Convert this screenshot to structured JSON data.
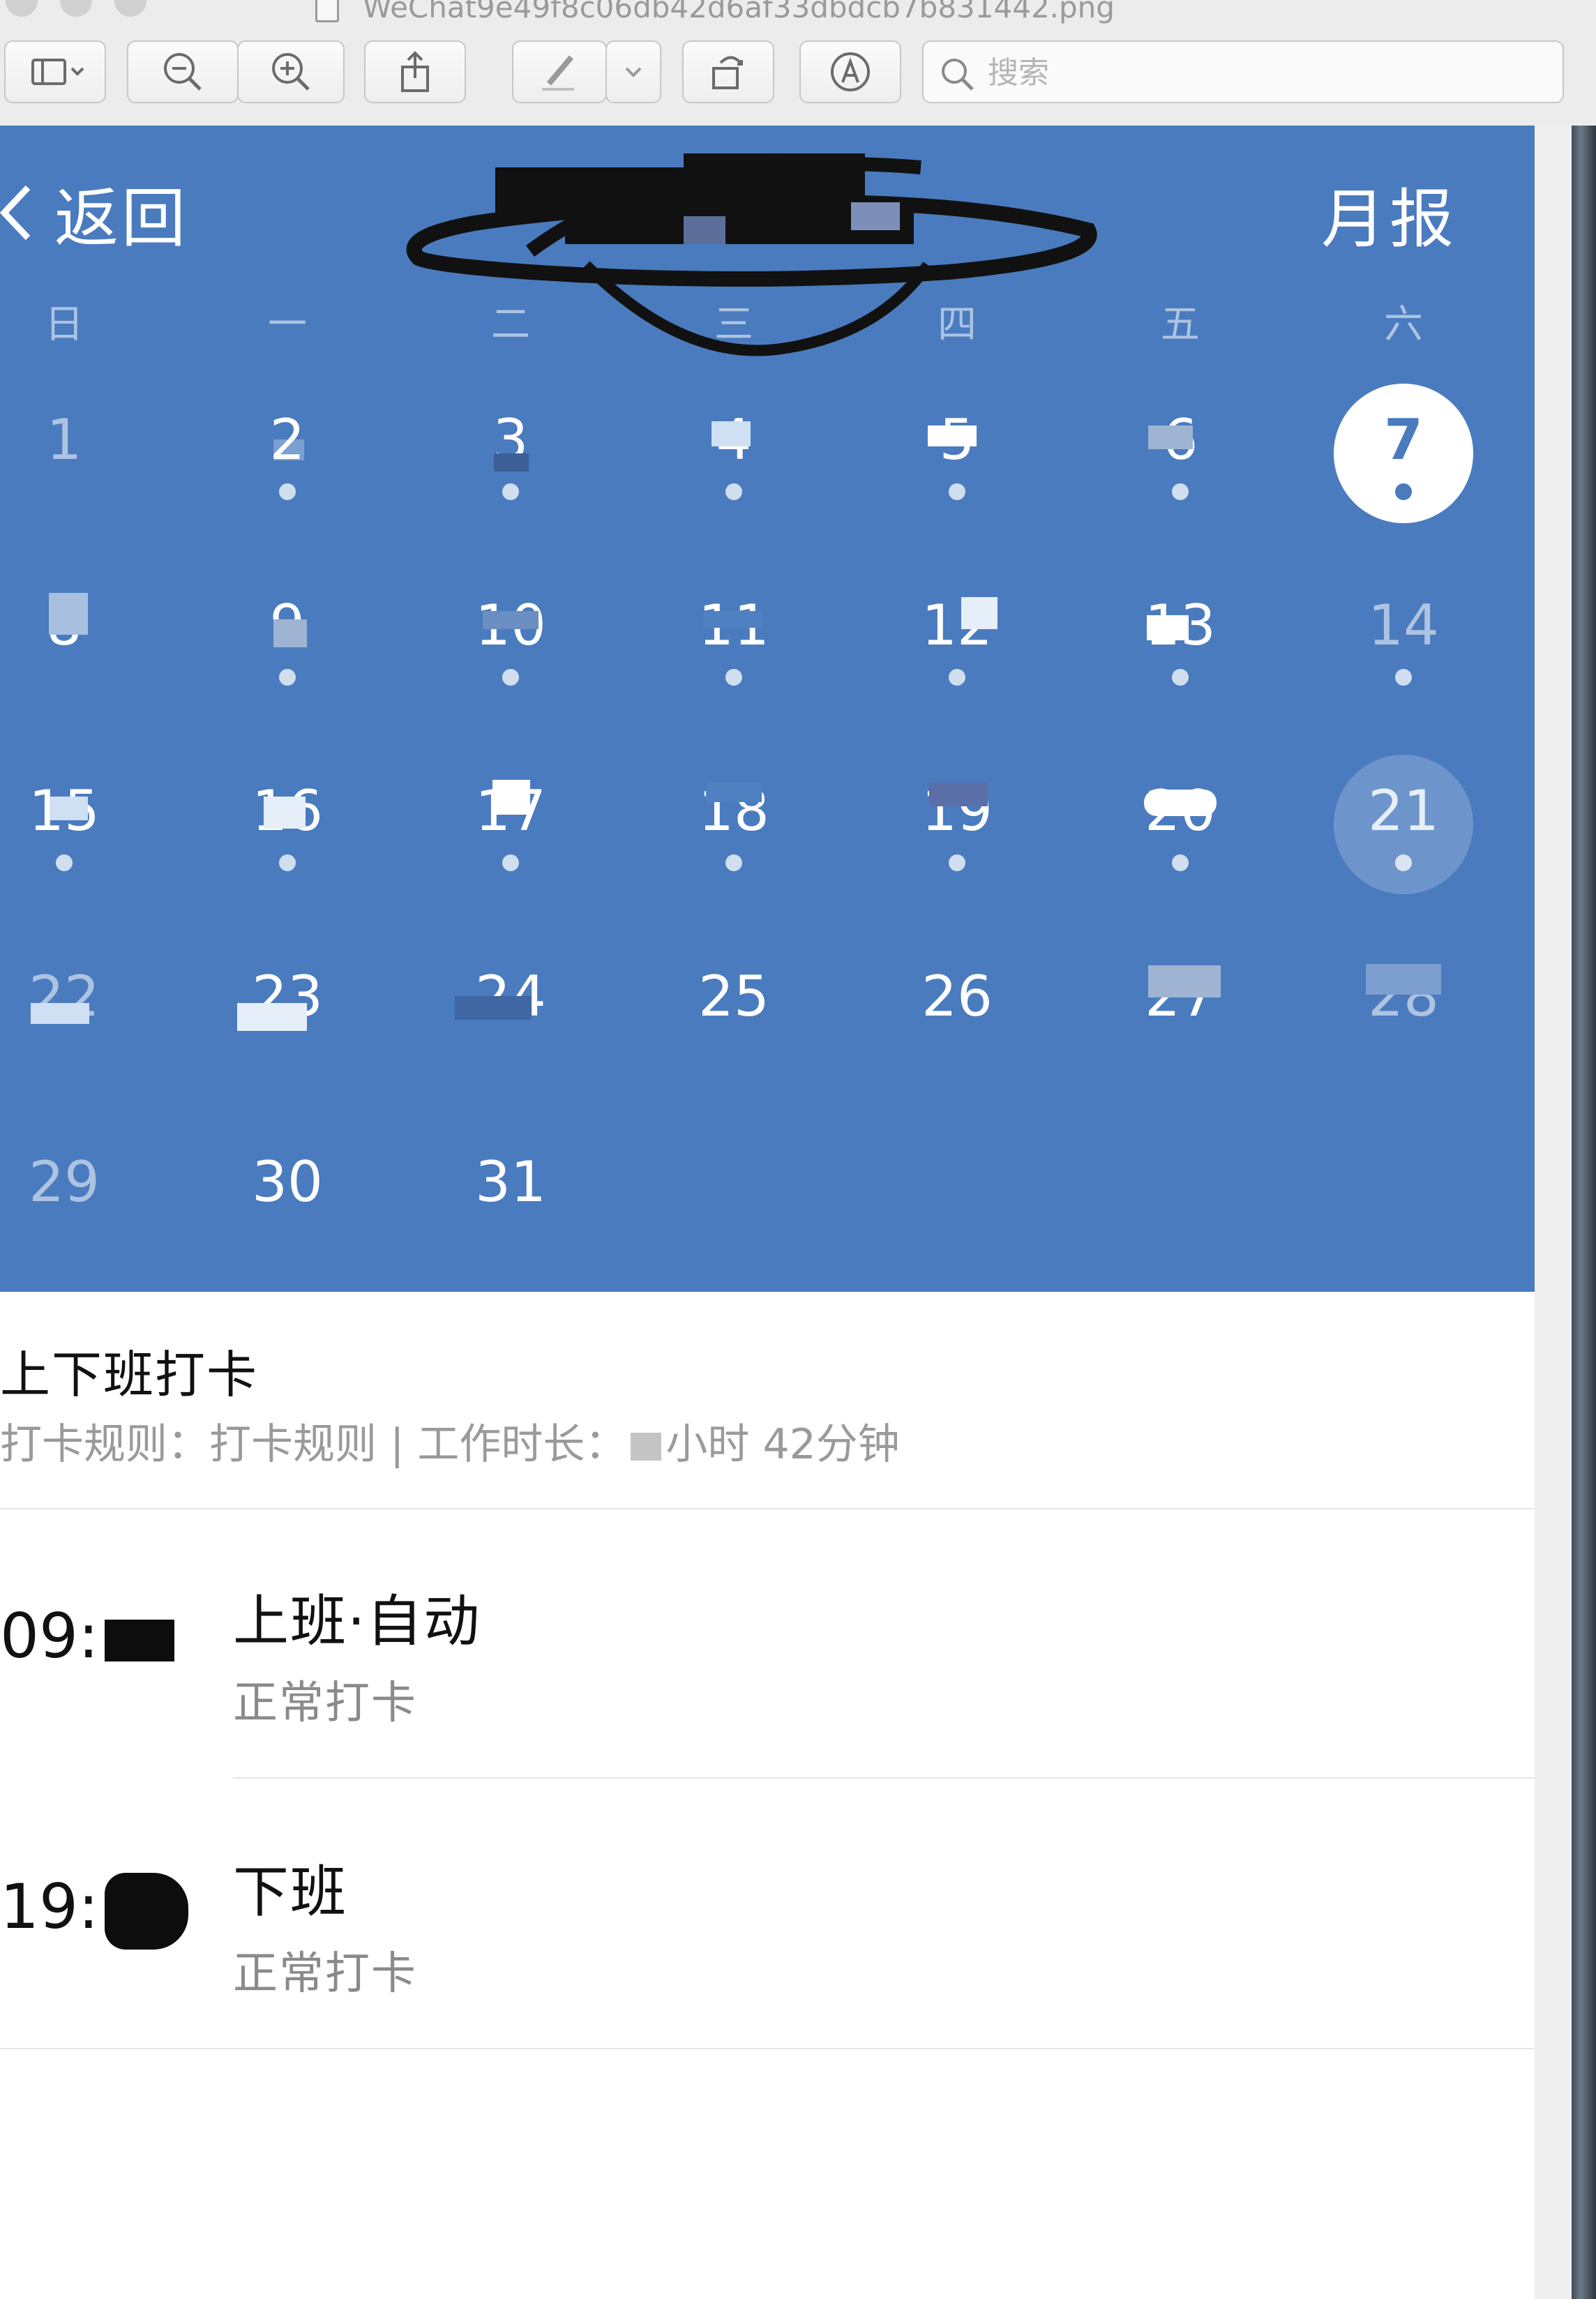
{
  "window": {
    "title": "WeChat9e49f8c06db42d6af33dbdcb7b831442.png"
  },
  "toolbar": {
    "search_placeholder": "搜索"
  },
  "nav": {
    "back_label": "返回",
    "title": "",
    "report_label": "月报"
  },
  "calendar": {
    "weekdays": [
      "日",
      "一",
      "二",
      "三",
      "四",
      "五",
      "六"
    ],
    "today": "7",
    "selected": "21",
    "days": {
      "d1": "1",
      "d2": "2",
      "d3": "3",
      "d4": "4",
      "d5": "5",
      "d6": "6",
      "d7": "7",
      "d8": "8",
      "d9": "9",
      "d10": "10",
      "d11": "11",
      "d12": "12",
      "d13": "13",
      "d14": "14",
      "d15": "15",
      "d16": "16",
      "d17": "17",
      "d18": "18",
      "d19": "19",
      "d20": "20",
      "d21": "21",
      "d22": "22",
      "d23": "23",
      "d24": "24",
      "d25": "25",
      "d26": "26",
      "d27": "27",
      "d28": "28",
      "d29": "29",
      "d30": "30",
      "d31": "31"
    },
    "accent_color": "#4a7bbe"
  },
  "attendance": {
    "title": "上下班打卡",
    "rule_prefix": "打卡规则：打卡规则 | 工作时长：",
    "hours_suffix": "小时",
    "minutes_value": "42",
    "minutes_suffix": "分钟"
  },
  "records": [
    {
      "time_visible": "09:",
      "label": "上班·自动",
      "status": "正常打卡"
    },
    {
      "time_visible": "19:",
      "label": "下班",
      "status": "正常打卡"
    }
  ]
}
